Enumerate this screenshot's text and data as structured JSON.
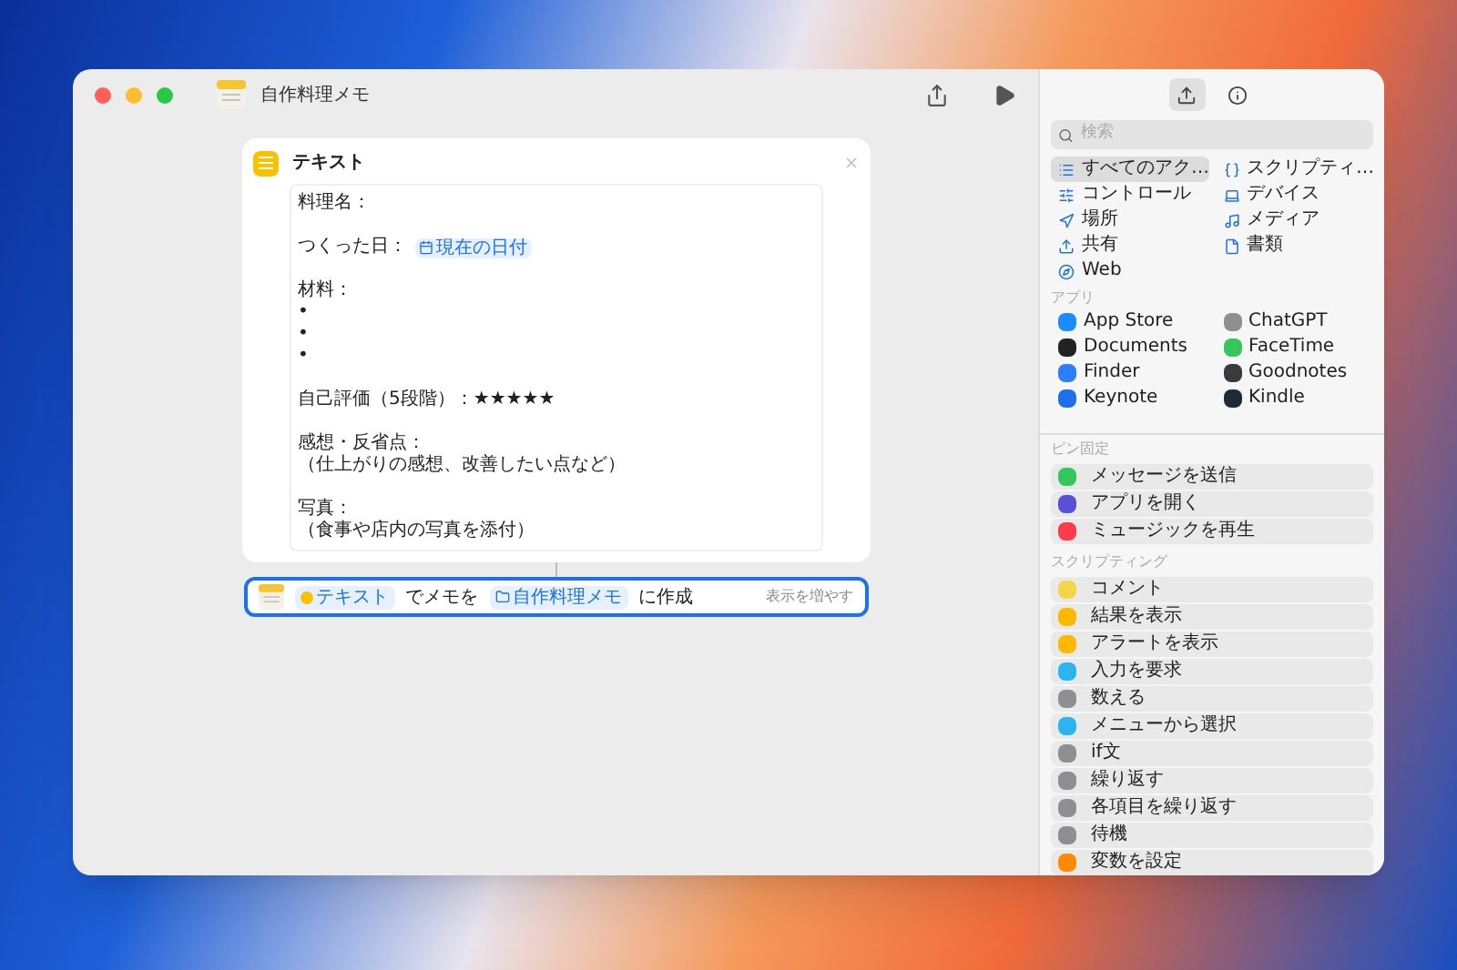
{
  "window": {
    "title": "自作料理メモ"
  },
  "sidebar_tabs": [
    {
      "kind": "actions",
      "selected": true
    },
    {
      "kind": "info",
      "selected": false
    }
  ],
  "search": {
    "placeholder": "検索"
  },
  "categories": [
    {
      "label": "すべてのアク…",
      "selected": true
    },
    {
      "label": "スクリプティ…",
      "selected": false
    },
    {
      "label": "コントロール",
      "selected": false
    },
    {
      "label": "デバイス",
      "selected": false
    },
    {
      "label": "場所",
      "selected": false
    },
    {
      "label": "メディア",
      "selected": false
    },
    {
      "label": "共有",
      "selected": false
    },
    {
      "label": "書類",
      "selected": false
    },
    {
      "label": "Web",
      "selected": false
    }
  ],
  "apps": {
    "heading": "アプリ",
    "items": [
      {
        "label": "App Store",
        "color": "#1a8cff"
      },
      {
        "label": "ChatGPT",
        "color": "#8e8e93"
      },
      {
        "label": "Documents",
        "color": "#222222"
      },
      {
        "label": "FaceTime",
        "color": "#34c759"
      },
      {
        "label": "Finder",
        "color": "#2d7ff9"
      },
      {
        "label": "Goodnotes",
        "color": "#3a3a3c"
      },
      {
        "label": "Keynote",
        "color": "#1f6feb"
      },
      {
        "label": "Kindle",
        "color": "#1c2b36"
      }
    ]
  },
  "pinned": {
    "heading": "ピン固定",
    "items": [
      {
        "label": "メッセージを送信",
        "color": "#34c759"
      },
      {
        "label": "アプリを開く",
        "color": "#5b4fd8"
      },
      {
        "label": "ミュージックを再生",
        "color": "#fa3c4c"
      }
    ]
  },
  "scripting": {
    "heading": "スクリプティング",
    "items": [
      {
        "label": "コメント",
        "color": "#f5d547"
      },
      {
        "label": "結果を表示",
        "color": "#ffb800"
      },
      {
        "label": "アラートを表示",
        "color": "#ffb800"
      },
      {
        "label": "入力を要求",
        "color": "#2bb5f0"
      },
      {
        "label": "数える",
        "color": "#8e8e93"
      },
      {
        "label": "メニューから選択",
        "color": "#2bb5f0"
      },
      {
        "label": "if文",
        "color": "#8e8e93"
      },
      {
        "label": "繰り返す",
        "color": "#8e8e93"
      },
      {
        "label": "各項目を繰り返す",
        "color": "#8e8e93"
      },
      {
        "label": "待機",
        "color": "#8e8e93"
      },
      {
        "label": "変数を設定",
        "color": "#ff8a00"
      }
    ]
  },
  "text_action": {
    "title": "テキスト",
    "lines": [
      {
        "kind": "text",
        "text": "料理名："
      },
      {
        "kind": "blank"
      },
      {
        "kind": "token",
        "text": "つくった日：",
        "token": "現在の日付"
      },
      {
        "kind": "blank"
      },
      {
        "kind": "text",
        "text": "材料："
      },
      {
        "kind": "text",
        "text": "•"
      },
      {
        "kind": "text",
        "text": "•"
      },
      {
        "kind": "text",
        "text": "•"
      },
      {
        "kind": "blank"
      },
      {
        "kind": "text",
        "text": "自己評価（5段階）：★★★★★"
      },
      {
        "kind": "blank"
      },
      {
        "kind": "text",
        "text": "感想・反省点："
      },
      {
        "kind": "text",
        "text": "（仕上がりの感想、改善したい点など）"
      },
      {
        "kind": "blank"
      },
      {
        "kind": "text",
        "text": "写真："
      },
      {
        "kind": "text",
        "text": "（食事や店内の写真を添付）"
      }
    ]
  },
  "note_action": {
    "selected": true,
    "parts": [
      {
        "kind": "text_token",
        "text": "テキスト"
      },
      {
        "kind": "text",
        "text": "でメモを"
      },
      {
        "kind": "folder_token",
        "text": "自作料理メモ"
      },
      {
        "kind": "text",
        "text": "に作成"
      }
    ],
    "more": "表示を増やす"
  }
}
